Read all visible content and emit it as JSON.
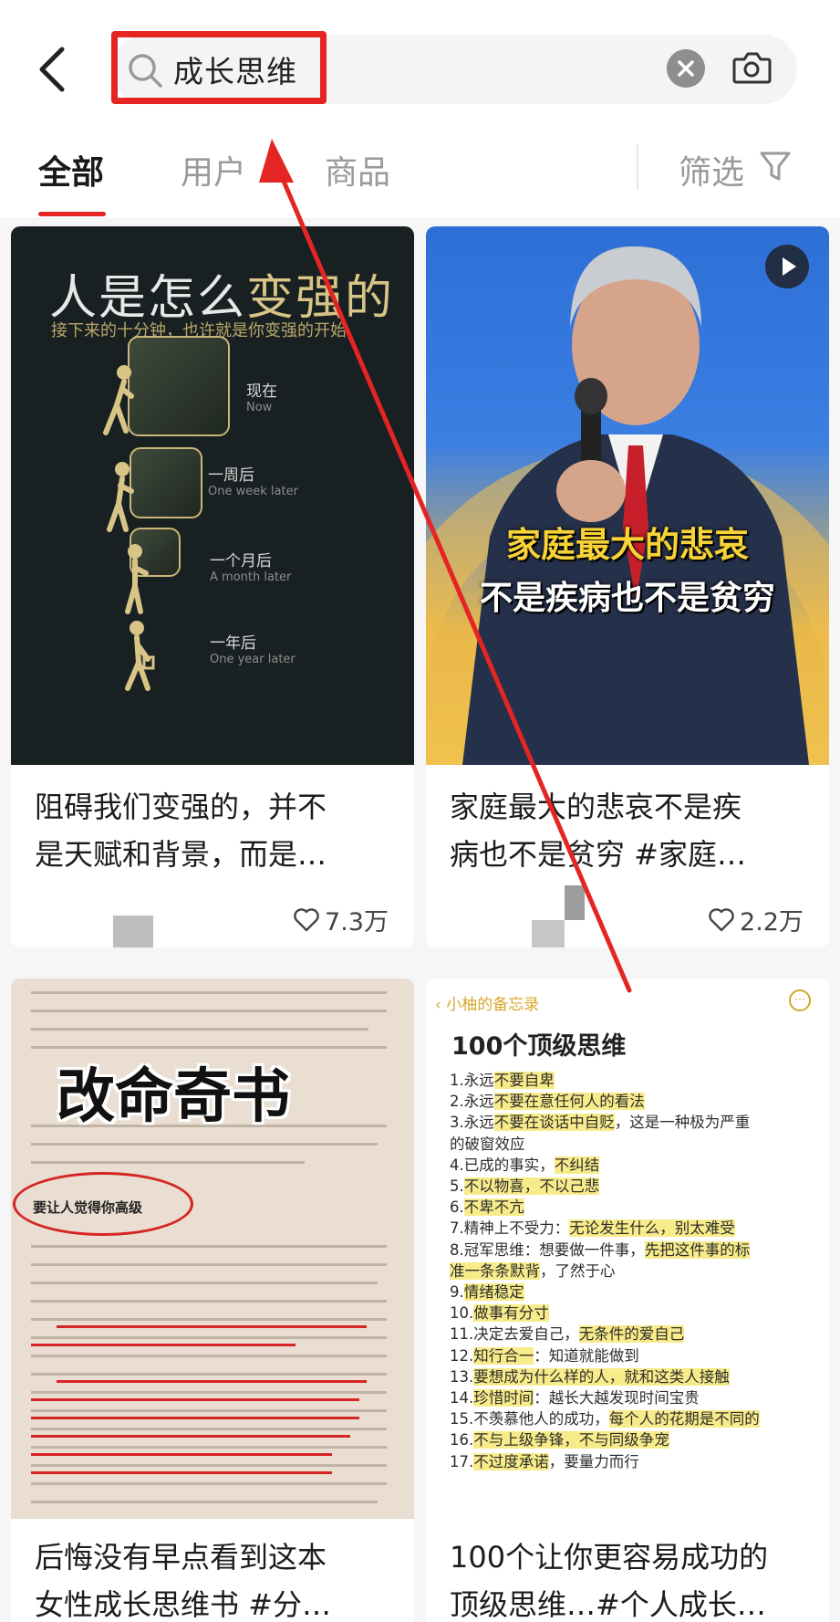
{
  "search": {
    "query": "成长思维"
  },
  "tabs": [
    {
      "label": "全部"
    },
    {
      "label": "用户"
    },
    {
      "label": "商品"
    }
  ],
  "filter_label": "筛选",
  "colors": {
    "accent": "#e52424",
    "highlight": "#f8ec8a"
  },
  "icons": [
    "back-arrow-icon",
    "search-icon",
    "clear-icon",
    "camera-icon",
    "filter-icon",
    "play-icon",
    "heart-icon"
  ],
  "cards": [
    {
      "image_title_a": "人是怎么",
      "image_title_b": "变强的",
      "image_subtitle": "接下来的十分钟，也许就是你变强的开始",
      "stages": [
        {
          "cn": "现在",
          "en": "Now"
        },
        {
          "cn": "一周后",
          "en": "One week later"
        },
        {
          "cn": "一个月后",
          "en": "A month later"
        },
        {
          "cn": "一年后",
          "en": "One year later"
        }
      ],
      "title_line1": "阻碍我们变强的，并不",
      "title_line2": "是天赋和背景，而是…",
      "likes": "7.3万"
    },
    {
      "caption1": "家庭最大的悲哀",
      "caption2": "不是疾病也不是贫穷",
      "title_line1": "家庭最大的悲哀不是疾",
      "title_line2": "病也不是贫穷 #家庭…",
      "likes": "2.2万"
    },
    {
      "overlay_title": "改命奇书",
      "heading": "要让人觉得你高级",
      "title_line1": "后悔没有早点看到这本",
      "title_line2": "女性成长思维书 #分…"
    },
    {
      "back_label": "小柚的备忘录",
      "heading": "100个顶级思维",
      "items": [
        {
          "plain": "1.永远",
          "mark": "不要自卑",
          "rest": ""
        },
        {
          "plain": "2.永远",
          "mark": "不要在意任何人的看法",
          "rest": ""
        },
        {
          "plain": "3.永远",
          "mark": "不要在谈话中自贬",
          "rest": "，这是一种极为严重"
        },
        {
          "plain": "的破窗效应",
          "mark": "",
          "rest": ""
        },
        {
          "plain": "4.已成的事实，",
          "mark": "不纠结",
          "rest": ""
        },
        {
          "plain": "5.",
          "mark": "不以物喜，不以己悲",
          "rest": ""
        },
        {
          "plain": "6.",
          "mark": "不卑不亢",
          "rest": ""
        },
        {
          "plain": "7.精神上不受力：",
          "mark": "无论发生什么，别太难受",
          "rest": ""
        },
        {
          "plain": "8.冠军思维：想要做一件事，",
          "mark": "先把这件事的标",
          "rest": ""
        },
        {
          "plain": "",
          "mark": "准一条条默背",
          "rest": "，了然于心"
        },
        {
          "plain": "9.",
          "mark": "情绪稳定",
          "rest": ""
        },
        {
          "plain": "10.",
          "mark": "做事有分寸",
          "rest": ""
        },
        {
          "plain": "11.决定去爱自己，",
          "mark": "无条件的爱自己",
          "rest": ""
        },
        {
          "plain": "12.",
          "mark": "知行合一",
          "rest": "：知道就能做到"
        },
        {
          "plain": "13.",
          "mark": "要想成为什么样的人，就和这类人接触",
          "rest": ""
        },
        {
          "plain": "14.",
          "mark": "珍惜时间",
          "rest": "：越长大越发现时间宝贵"
        },
        {
          "plain": "15.不羡慕他人的成功，",
          "mark": "每个人的花期是不同的",
          "rest": ""
        },
        {
          "plain": "16.",
          "mark": "不与上级争锋，不与同级争宠",
          "rest": ""
        },
        {
          "plain": "17.",
          "mark": "不过度承诺",
          "rest": "，要量力而行"
        }
      ],
      "title_line1": "100个让你更容易成功的",
      "title_line2": "顶级思维…#个人成长…"
    }
  ]
}
